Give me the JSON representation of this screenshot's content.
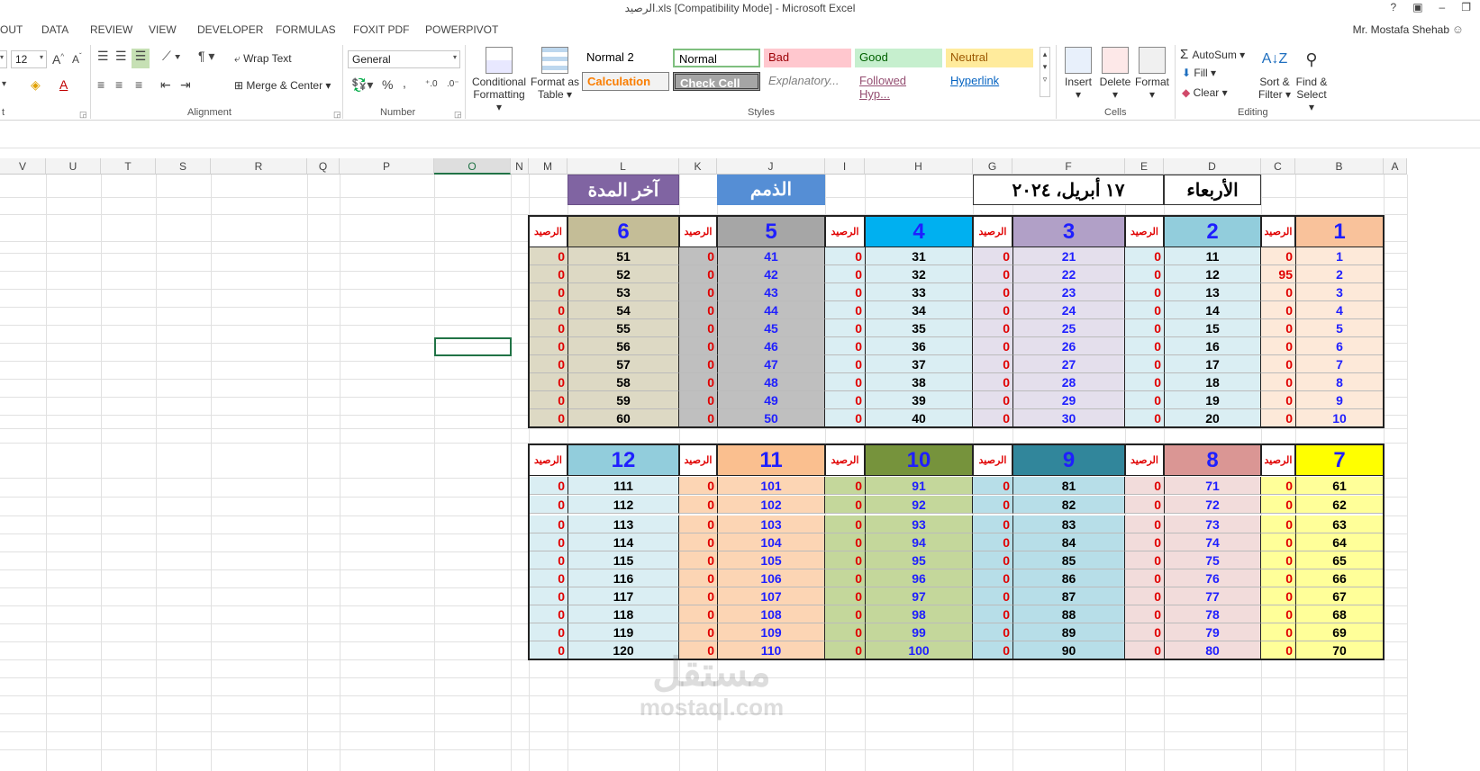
{
  "window": {
    "title": "الرصيد.xls  [Compatibility Mode] - Microsoft Excel",
    "buttons": [
      "?",
      "▣",
      "–",
      "❐"
    ]
  },
  "menu": {
    "tabs": [
      "OUT",
      "DATA",
      "REVIEW",
      "VIEW",
      "DEVELOPER",
      "FORMULAS",
      "FOXIT PDF",
      "POWERPIVOT"
    ],
    "user": "Mr. Mostafa Shehab"
  },
  "ribbon": {
    "font_size": "12",
    "font_group_label": "t",
    "wrap_text": "Wrap Text",
    "merge_center": "Merge & Center",
    "alignment_label": "Alignment",
    "number_format": "General",
    "percent": "%",
    "comma": ",",
    "number_label": "Number",
    "conditional_formatting": [
      "Conditional",
      "Formatting"
    ],
    "format_as_table": [
      "Format as",
      "Table"
    ],
    "styles_label": "Styles",
    "styles": [
      {
        "name": "Normal 2",
        "bg": "#ffffff",
        "fg": "#000000"
      },
      {
        "name": "Normal",
        "bg": "#ffffff",
        "fg": "#000000"
      },
      {
        "name": "Bad",
        "bg": "#ffc7ce",
        "fg": "#9c0006"
      },
      {
        "name": "Good",
        "bg": "#c6efce",
        "fg": "#006100"
      },
      {
        "name": "Neutral",
        "bg": "#ffeb9c",
        "fg": "#9c5700"
      },
      {
        "name": "Calculation",
        "bg": "#f2f2f2",
        "fg": "#fa7d00"
      },
      {
        "name": "Check Cell",
        "bg": "#a5a5a5",
        "fg": "#ffffff"
      },
      {
        "name": "Explanatory...",
        "bg": "#ffffff",
        "fg": "#7f7f7f"
      },
      {
        "name": "Followed Hyp...",
        "bg": "#ffffff",
        "fg": "#954f72"
      },
      {
        "name": "Hyperlink",
        "bg": "#ffffff",
        "fg": "#0563c1"
      }
    ],
    "insert": "Insert",
    "delete": "Delete",
    "format": "Format",
    "cells_label": "Cells",
    "autosum": "AutoSum",
    "fill": "Fill",
    "clear": "Clear",
    "sort_filter": [
      "Sort &",
      "Filter"
    ],
    "find_select": [
      "Find &",
      "Select"
    ],
    "editing_label": "Editing"
  },
  "columns": [
    "V",
    "U",
    "T",
    "S",
    "R",
    "Q",
    "P",
    "O",
    "N",
    "M",
    "L",
    "K",
    "J",
    "I",
    "H",
    "G",
    "F",
    "E",
    "D",
    "C",
    "B",
    "A"
  ],
  "sheet": {
    "day": "الأربعاء",
    "date": "١٧ أبريل، ٢٠٢٤",
    "dues_label": "الذمم",
    "end_label": "آخر المدة",
    "balance_label": "الرصيد",
    "block1": {
      "headers": [
        "1",
        "2",
        "3",
        "4",
        "5",
        "6"
      ],
      "header_colors": [
        "#f9c29b",
        "#92cddc",
        "#b1a0c7",
        "#00b0f0",
        "#a6a6a6",
        "#c4bd97"
      ],
      "body_colors": [
        "#fde9d9",
        "#daeef3",
        "#e4dfec",
        "#daeef3",
        "#bfbfbf",
        "#ddd9c4"
      ],
      "text_colors": [
        "#1f1fff",
        "#000000",
        "#1f1fff",
        "#000000",
        "#1f1fff",
        "#000000"
      ],
      "numbers": [
        [
          "1",
          "2",
          "3",
          "4",
          "5",
          "6",
          "7",
          "8",
          "9",
          "10"
        ],
        [
          "11",
          "12",
          "13",
          "14",
          "15",
          "16",
          "17",
          "18",
          "19",
          "20"
        ],
        [
          "21",
          "22",
          "23",
          "24",
          "25",
          "26",
          "27",
          "28",
          "29",
          "30"
        ],
        [
          "31",
          "32",
          "33",
          "34",
          "35",
          "36",
          "37",
          "38",
          "39",
          "40"
        ],
        [
          "41",
          "42",
          "43",
          "44",
          "45",
          "46",
          "47",
          "48",
          "49",
          "50"
        ],
        [
          "51",
          "52",
          "53",
          "54",
          "55",
          "56",
          "57",
          "58",
          "59",
          "60"
        ]
      ],
      "balances": [
        [
          "0",
          "95",
          "0",
          "0",
          "0",
          "0",
          "0",
          "0",
          "0",
          "0"
        ],
        [
          "0",
          "0",
          "0",
          "0",
          "0",
          "0",
          "0",
          "0",
          "0",
          "0"
        ],
        [
          "0",
          "0",
          "0",
          "0",
          "0",
          "0",
          "0",
          "0",
          "0",
          "0"
        ],
        [
          "0",
          "0",
          "0",
          "0",
          "0",
          "0",
          "0",
          "0",
          "0",
          "0"
        ],
        [
          "0",
          "0",
          "0",
          "0",
          "0",
          "0",
          "0",
          "0",
          "0",
          "0"
        ],
        [
          "0",
          "0",
          "0",
          "0",
          "0",
          "0",
          "0",
          "0",
          "0",
          "0"
        ]
      ]
    },
    "block2": {
      "headers": [
        "7",
        "8",
        "9",
        "10",
        "11",
        "12"
      ],
      "header_colors": [
        "#ffff00",
        "#da9694",
        "#31869b",
        "#76933c",
        "#fabf8f",
        "#92cddc"
      ],
      "header_text_colors": [
        "#1f1fff",
        "#1f1fff",
        "#1f1fff",
        "#1f1fff",
        "#1f1fff",
        "#1f1fff"
      ],
      "body_colors": [
        "#ffff99",
        "#f2dcdb",
        "#b7dee8",
        "#c4d79b",
        "#fcd5b4",
        "#daeef3"
      ],
      "side_colors": [
        "#ffff99",
        "#f2dcdb",
        "#b7dee8",
        "#c4d79b",
        "#fcd5b4",
        "#daeef3"
      ],
      "text_colors": [
        "#000000",
        "#1f1fff",
        "#000000",
        "#1f1fff",
        "#1f1fff",
        "#000000"
      ],
      "numbers": [
        [
          "61",
          "62",
          "63",
          "64",
          "65",
          "66",
          "67",
          "68",
          "69",
          "70"
        ],
        [
          "71",
          "72",
          "73",
          "74",
          "75",
          "76",
          "77",
          "78",
          "79",
          "80"
        ],
        [
          "81",
          "82",
          "83",
          "84",
          "85",
          "86",
          "87",
          "88",
          "89",
          "90"
        ],
        [
          "91",
          "92",
          "93",
          "94",
          "95",
          "96",
          "97",
          "98",
          "99",
          "100"
        ],
        [
          "101",
          "102",
          "103",
          "104",
          "105",
          "106",
          "107",
          "108",
          "109",
          "110"
        ],
        [
          "111",
          "112",
          "113",
          "114",
          "115",
          "116",
          "117",
          "118",
          "119",
          "120"
        ]
      ],
      "balances": [
        [
          "0",
          "0",
          "0",
          "0",
          "0",
          "0",
          "0",
          "0",
          "0",
          "0"
        ],
        [
          "0",
          "0",
          "0",
          "0",
          "0",
          "0",
          "0",
          "0",
          "0",
          "0"
        ],
        [
          "0",
          "0",
          "0",
          "0",
          "0",
          "0",
          "0",
          "0",
          "0",
          "0"
        ],
        [
          "0",
          "0",
          "0",
          "0",
          "0",
          "0",
          "0",
          "0",
          "0",
          "0"
        ],
        [
          "0",
          "0",
          "0",
          "0",
          "0",
          "0",
          "0",
          "0",
          "0",
          "0"
        ],
        [
          "0",
          "0",
          "0",
          "0",
          "0",
          "0",
          "0",
          "0",
          "0",
          "0"
        ]
      ]
    }
  },
  "watermark": {
    "arabic": "مستقل",
    "latin": "mostaql.com"
  }
}
